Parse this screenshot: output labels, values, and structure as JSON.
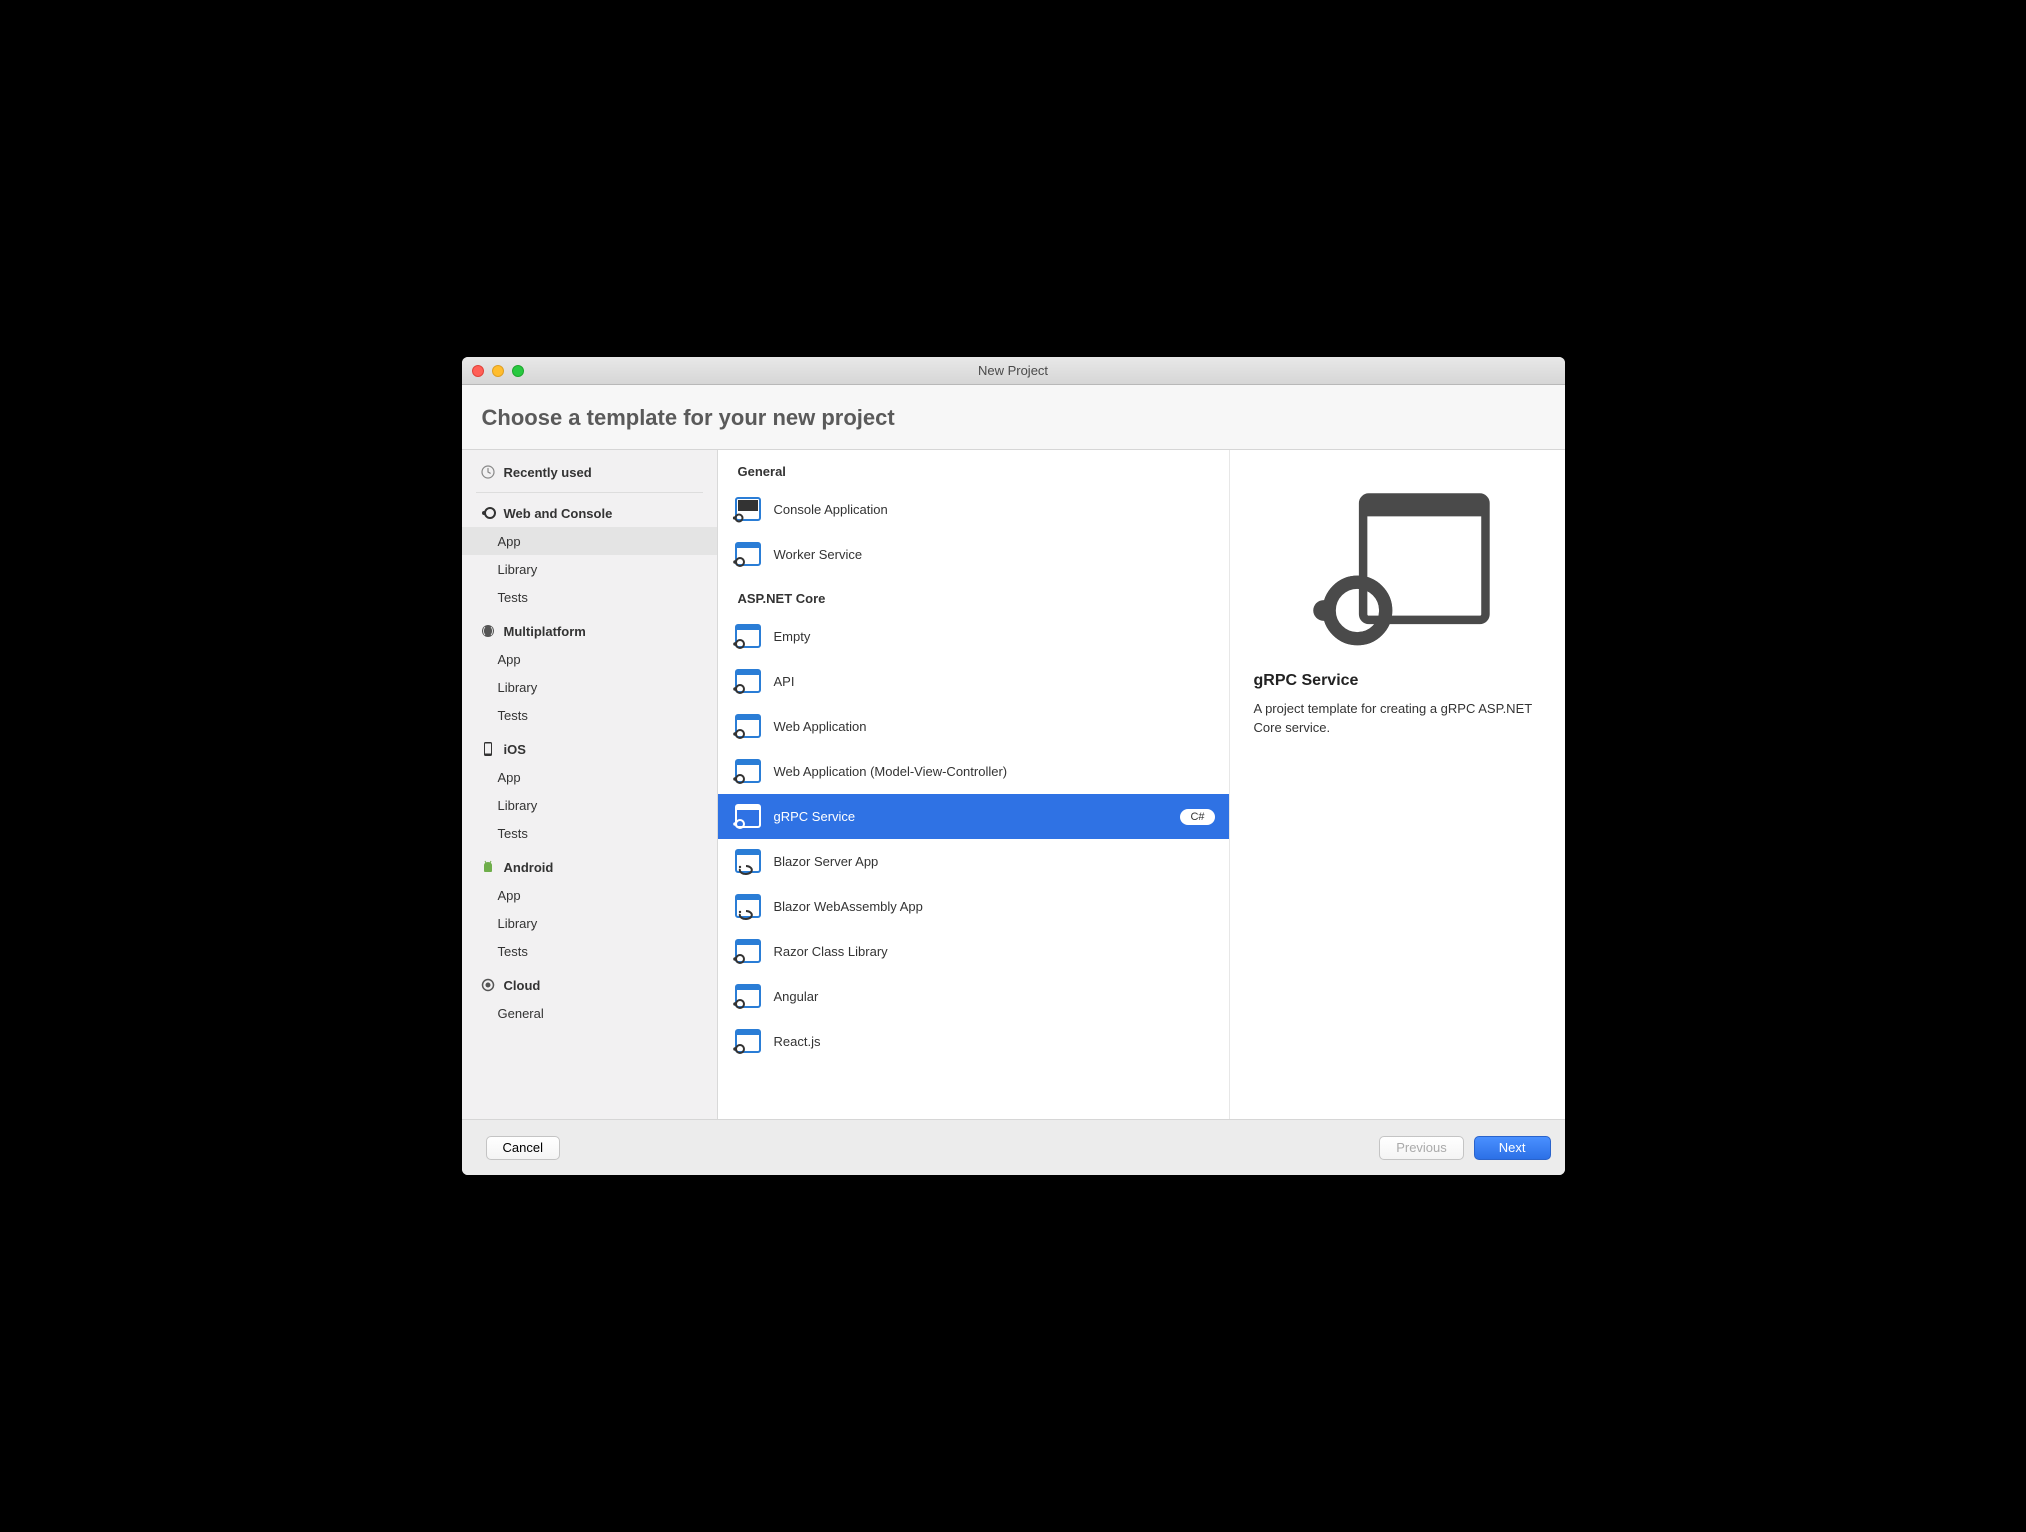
{
  "window": {
    "title": "New Project",
    "heading": "Choose a template for your new project"
  },
  "sidebar": {
    "recently_used": "Recently used",
    "categories": [
      {
        "label": "Web and Console",
        "icon": "dotnet",
        "items": [
          "App",
          "Library",
          "Tests"
        ],
        "selected_item": 0
      },
      {
        "label": "Multiplatform",
        "icon": "multiplatform",
        "items": [
          "App",
          "Library",
          "Tests"
        ]
      },
      {
        "label": "iOS",
        "icon": "phone",
        "items": [
          "App",
          "Library",
          "Tests"
        ]
      },
      {
        "label": "Android",
        "icon": "android",
        "items": [
          "App",
          "Library",
          "Tests"
        ]
      },
      {
        "label": "Cloud",
        "icon": "cloud",
        "items": [
          "General"
        ]
      }
    ]
  },
  "templates": {
    "groups": [
      {
        "title": "General",
        "items": [
          {
            "label": "Console Application",
            "icon": "console"
          },
          {
            "label": "Worker Service",
            "icon": "net"
          }
        ]
      },
      {
        "title": "ASP.NET Core",
        "items": [
          {
            "label": "Empty",
            "icon": "net"
          },
          {
            "label": "API",
            "icon": "net"
          },
          {
            "label": "Web Application",
            "icon": "net"
          },
          {
            "label": "Web Application (Model-View-Controller)",
            "icon": "net"
          },
          {
            "label": "gRPC Service",
            "icon": "net",
            "selected": true,
            "badge": "C#"
          },
          {
            "label": "Blazor Server App",
            "icon": "blazor"
          },
          {
            "label": "Blazor WebAssembly App",
            "icon": "blazor"
          },
          {
            "label": "Razor Class Library",
            "icon": "net"
          },
          {
            "label": "Angular",
            "icon": "net"
          },
          {
            "label": "React.js",
            "icon": "net"
          }
        ]
      }
    ]
  },
  "details": {
    "title": "gRPC Service",
    "description": "A project template for creating a gRPC ASP.NET Core service."
  },
  "footer": {
    "cancel": "Cancel",
    "previous": "Previous",
    "next": "Next"
  }
}
